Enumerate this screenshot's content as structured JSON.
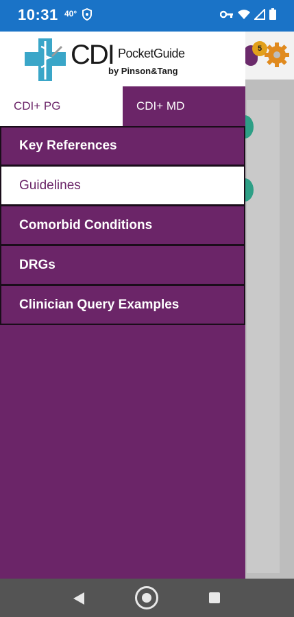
{
  "status_bar": {
    "time": "10:31",
    "temperature": "40°",
    "badge_count": "5"
  },
  "logo": {
    "cdi": "CDI",
    "pocket_guide": "PocketGuide",
    "byline": "by Pinson&Tang"
  },
  "tabs": [
    {
      "label": "CDI+ PG",
      "active": true
    },
    {
      "label": "CDI+ MD",
      "active": false
    }
  ],
  "menu": [
    {
      "label": "Key References",
      "active": false
    },
    {
      "label": "Guidelines",
      "active": true
    },
    {
      "label": "Comorbid Conditions",
      "active": false
    },
    {
      "label": "DRGs",
      "active": false
    },
    {
      "label": "Clinician Query Examples",
      "active": false
    }
  ],
  "colors": {
    "status_bar": "#1a73c7",
    "drawer": "#6b2568",
    "nav_bar": "#545454"
  }
}
